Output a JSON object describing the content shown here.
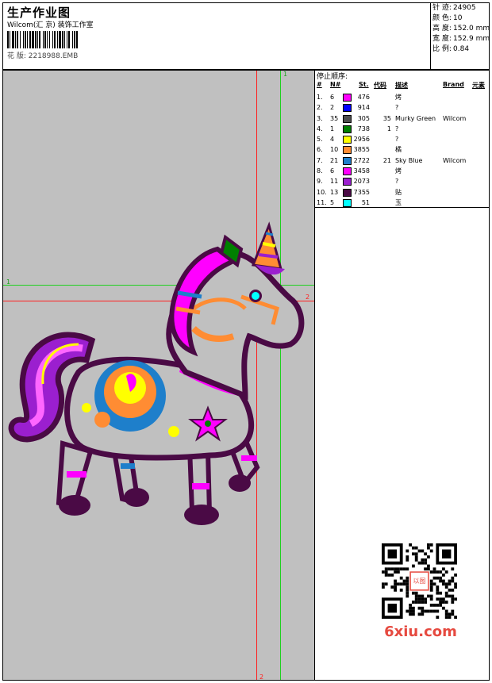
{
  "header": {
    "title": "生产作业图",
    "company": "Wilcom(汇 京) 装饰工作室",
    "design_file": "花 版: 2218988.EMB"
  },
  "stats": [
    {
      "key": "针 迹:",
      "value": "24905"
    },
    {
      "key": "颜 色:",
      "value": "10"
    },
    {
      "key": "高 度:",
      "value": "152.0 mm"
    },
    {
      "key": "宽 度:",
      "value": "152.9 mm"
    },
    {
      "key": "比 例:",
      "value": "0.84"
    }
  ],
  "color_sequence": {
    "title": "停止顺序:",
    "headers": {
      "order": "#",
      "n": "N#",
      "st": "St.",
      "code": "代码",
      "desc": "描述",
      "brand": "Brand",
      "element": "元素"
    },
    "rows": [
      {
        "order": "1.",
        "n": "6",
        "color": "#ff00ff",
        "st": "476",
        "code": "",
        "desc": "烤",
        "brand": ""
      },
      {
        "order": "2.",
        "n": "2",
        "color": "#0000ff",
        "st": "914",
        "code": "",
        "desc": "?",
        "brand": ""
      },
      {
        "order": "3.",
        "n": "35",
        "color": "#4d4d4d",
        "st": "305",
        "code": "35",
        "desc": "Murky Green",
        "brand": "Wilcom"
      },
      {
        "order": "4.",
        "n": "1",
        "color": "#008000",
        "st": "738",
        "code": "1",
        "desc": "?",
        "brand": ""
      },
      {
        "order": "5.",
        "n": "4",
        "color": "#ffff00",
        "st": "2956",
        "code": "",
        "desc": "?",
        "brand": ""
      },
      {
        "order": "6.",
        "n": "10",
        "color": "#ff8c33",
        "st": "3855",
        "code": "",
        "desc": "橘",
        "brand": ""
      },
      {
        "order": "7.",
        "n": "21",
        "color": "#1e7fcb",
        "st": "2722",
        "code": "21",
        "desc": "Sky Blue",
        "brand": "Wilcom"
      },
      {
        "order": "8.",
        "n": "6",
        "color": "#ff00ff",
        "st": "3458",
        "code": "",
        "desc": "烤",
        "brand": ""
      },
      {
        "order": "9.",
        "n": "11",
        "color": "#9b1fcf",
        "st": "2073",
        "code": "",
        "desc": "?",
        "brand": ""
      },
      {
        "order": "10.",
        "n": "13",
        "color": "#4a0a45",
        "st": "7355",
        "code": "",
        "desc": "贴",
        "brand": ""
      },
      {
        "order": "11.",
        "n": "5",
        "color": "#00ffff",
        "st": "51",
        "code": "",
        "desc": "玉",
        "brand": ""
      }
    ]
  },
  "guides": {
    "green_label": "1",
    "red_label": "2"
  },
  "watermark": {
    "logo_text": "6xiu.com",
    "seal_text": "以图"
  }
}
